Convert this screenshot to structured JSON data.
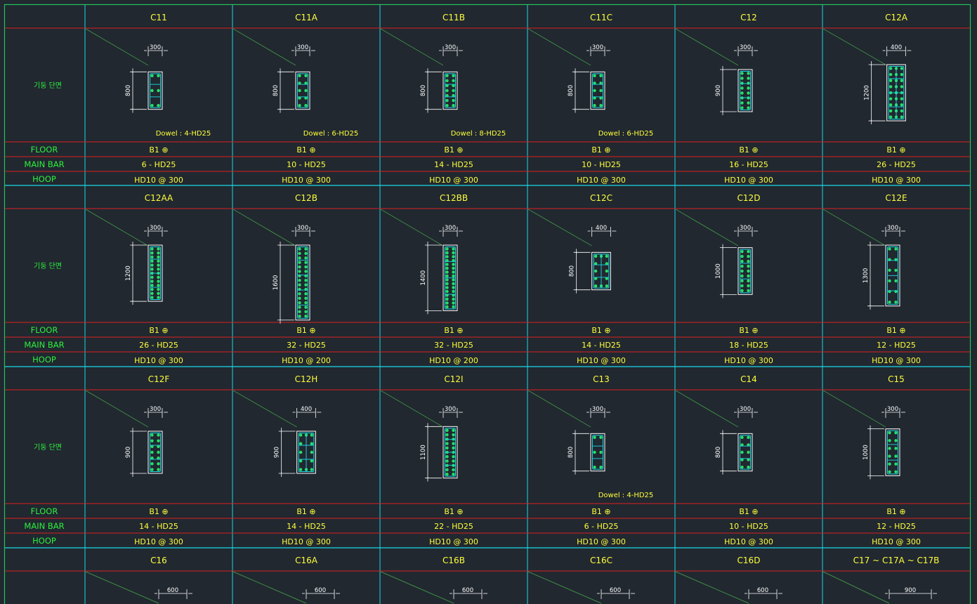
{
  "row_labels": {
    "section": "기둥 단면",
    "floor": "FLOOR",
    "main_bar": "MAIN BAR",
    "hoop": "HOOP"
  },
  "colors": {
    "background": "#212830",
    "grid_cyan": "#19d9e6",
    "grid_red": "#dd1f1f",
    "frame_green": "#22c25a",
    "text_yellow": "#ffff3a",
    "text_green": "#2df03c",
    "rebar_green": "#27e06a",
    "leader_green": "#3f8c44"
  },
  "bands": [
    {
      "columns": [
        {
          "name": "C11",
          "width": "300",
          "height": "800",
          "floor": "B1 ⊕",
          "main_bar": "6 - HD25",
          "hoop": "HD10 @ 300",
          "dowel": "Dowel : 4-HD25"
        },
        {
          "name": "C11A",
          "width": "300",
          "height": "800",
          "floor": "B1 ⊕",
          "main_bar": "10 - HD25",
          "hoop": "HD10 @ 300",
          "dowel": "Dowel : 6-HD25"
        },
        {
          "name": "C11B",
          "width": "300",
          "height": "800",
          "floor": "B1 ⊕",
          "main_bar": "14 - HD25",
          "hoop": "HD10 @ 300",
          "dowel": "Dowel : 8-HD25"
        },
        {
          "name": "C11C",
          "width": "300",
          "height": "800",
          "floor": "B1 ⊕",
          "main_bar": "10 - HD25",
          "hoop": "HD10 @ 300",
          "dowel": "Dowel : 6-HD25"
        },
        {
          "name": "C12",
          "width": "300",
          "height": "900",
          "floor": "B1 ⊕",
          "main_bar": "16 - HD25",
          "hoop": "HD10 @ 300",
          "dowel": ""
        },
        {
          "name": "C12A",
          "width": "400",
          "height": "1200",
          "floor": "B1 ⊕",
          "main_bar": "26 - HD25",
          "hoop": "HD10 @ 300",
          "dowel": ""
        }
      ]
    },
    {
      "columns": [
        {
          "name": "C12AA",
          "width": "300",
          "height": "1200",
          "floor": "B1 ⊕",
          "main_bar": "26 - HD25",
          "hoop": "HD10 @ 300",
          "dowel": ""
        },
        {
          "name": "C12B",
          "width": "300",
          "height": "1600",
          "floor": "B1 ⊕",
          "main_bar": "32 - HD25",
          "hoop": "HD10 @ 200",
          "dowel": ""
        },
        {
          "name": "C12BB",
          "width": "300",
          "height": "1400",
          "floor": "B1 ⊕",
          "main_bar": "32 - HD25",
          "hoop": "HD10 @ 200",
          "dowel": ""
        },
        {
          "name": "C12C",
          "width": "400",
          "height": "800",
          "floor": "B1 ⊕",
          "main_bar": "14 - HD25",
          "hoop": "HD10 @ 300",
          "dowel": ""
        },
        {
          "name": "C12D",
          "width": "300",
          "height": "1000",
          "floor": "B1 ⊕",
          "main_bar": "18 - HD25",
          "hoop": "HD10 @ 300",
          "dowel": ""
        },
        {
          "name": "C12E",
          "width": "300",
          "height": "1300",
          "floor": "B1 ⊕",
          "main_bar": "12 - HD25",
          "hoop": "HD10 @ 300",
          "dowel": ""
        }
      ]
    },
    {
      "columns": [
        {
          "name": "C12F",
          "width": "300",
          "height": "900",
          "floor": "B1 ⊕",
          "main_bar": "14 - HD25",
          "hoop": "HD10 @ 300",
          "dowel": ""
        },
        {
          "name": "C12H",
          "width": "400",
          "height": "900",
          "floor": "B1 ⊕",
          "main_bar": "14 - HD25",
          "hoop": "HD10 @ 300",
          "dowel": ""
        },
        {
          "name": "C12I",
          "width": "300",
          "height": "1100",
          "floor": "B1 ⊕",
          "main_bar": "22 - HD25",
          "hoop": "HD10 @ 300",
          "dowel": ""
        },
        {
          "name": "C13",
          "width": "300",
          "height": "800",
          "floor": "B1 ⊕",
          "main_bar": "6 - HD25",
          "hoop": "HD10 @ 300",
          "dowel": "Dowel : 4-HD25"
        },
        {
          "name": "C14",
          "width": "300",
          "height": "800",
          "floor": "B1 ⊕",
          "main_bar": "10 - HD25",
          "hoop": "HD10 @ 300",
          "dowel": ""
        },
        {
          "name": "C15",
          "width": "300",
          "height": "1000",
          "floor": "B1 ⊕",
          "main_bar": "12 - HD25",
          "hoop": "HD10 @ 300",
          "dowel": ""
        }
      ]
    },
    {
      "columns": [
        {
          "name": "C16",
          "width": "600"
        },
        {
          "name": "C16A",
          "width": "600"
        },
        {
          "name": "C16B",
          "width": "600"
        },
        {
          "name": "C16C",
          "width": "600"
        },
        {
          "name": "C16D",
          "width": "600"
        },
        {
          "name": "C17 ~ C17A ~ C17B",
          "width": "900"
        }
      ]
    }
  ]
}
